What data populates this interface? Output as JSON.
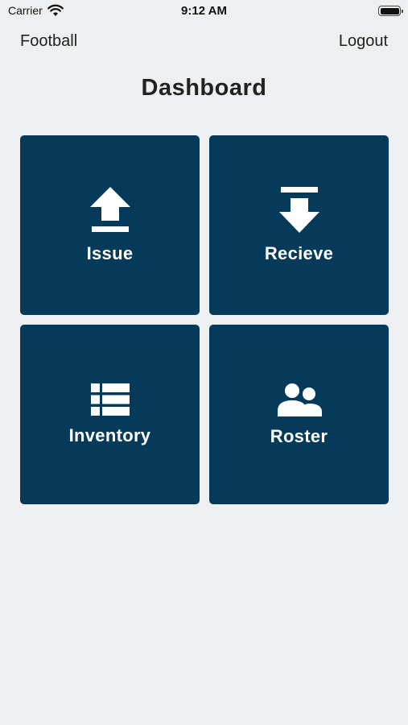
{
  "status_bar": {
    "carrier": "Carrier",
    "time": "9:12 AM"
  },
  "nav": {
    "left_label": "Football",
    "right_label": "Logout"
  },
  "title": "Dashboard",
  "tiles": [
    {
      "label": "Issue",
      "icon": "upload-icon"
    },
    {
      "label": "Recieve",
      "icon": "download-icon"
    },
    {
      "label": "Inventory",
      "icon": "list-icon"
    },
    {
      "label": "Roster",
      "icon": "users-icon"
    }
  ],
  "colors": {
    "background": "#eeeff1",
    "tile": "#053a5b",
    "tile_text": "#ffffff"
  }
}
